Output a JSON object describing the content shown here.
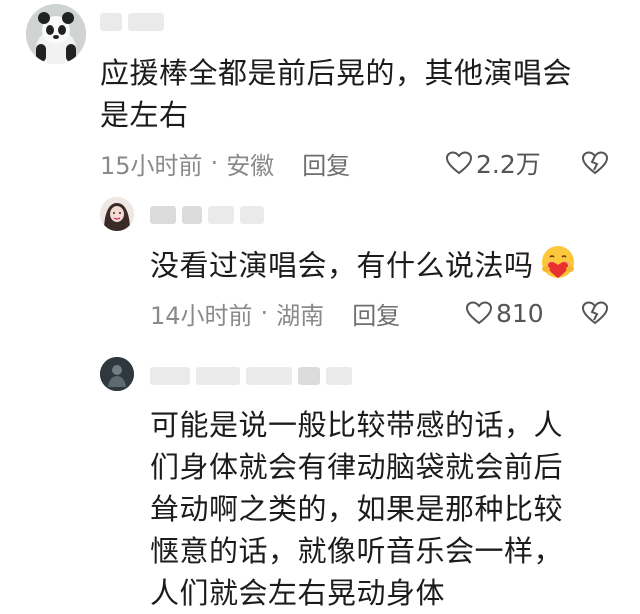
{
  "comments": [
    {
      "text": "应援棒全都是前后晃的，其他演唱会是左右",
      "line1": "应援棒全都是前后晃的，其他演唱会",
      "line2": "是左右",
      "time": "15小时前",
      "location": "安徽",
      "reply_label": "回复",
      "likes": "2.2万"
    },
    {
      "text": "没看过演唱会，有什么说法吗",
      "emoji": "hug-face-with-heart",
      "time": "14小时前",
      "location": "湖南",
      "reply_label": "回复",
      "likes": "810"
    },
    {
      "line1": "可能是说一般比较带感的话，人",
      "line2": "们身体就会有律动脑袋就会前后",
      "line3": "耸动啊之类的，如果是那种比较",
      "line4": "惬意的话，就像听音乐会一样，",
      "line5": "人们就会左右晃动身体"
    }
  ],
  "separator": "·",
  "colors": {
    "text": "#1c1c1c",
    "meta": "#8a8a8a",
    "blur": "#cfcfcf"
  }
}
